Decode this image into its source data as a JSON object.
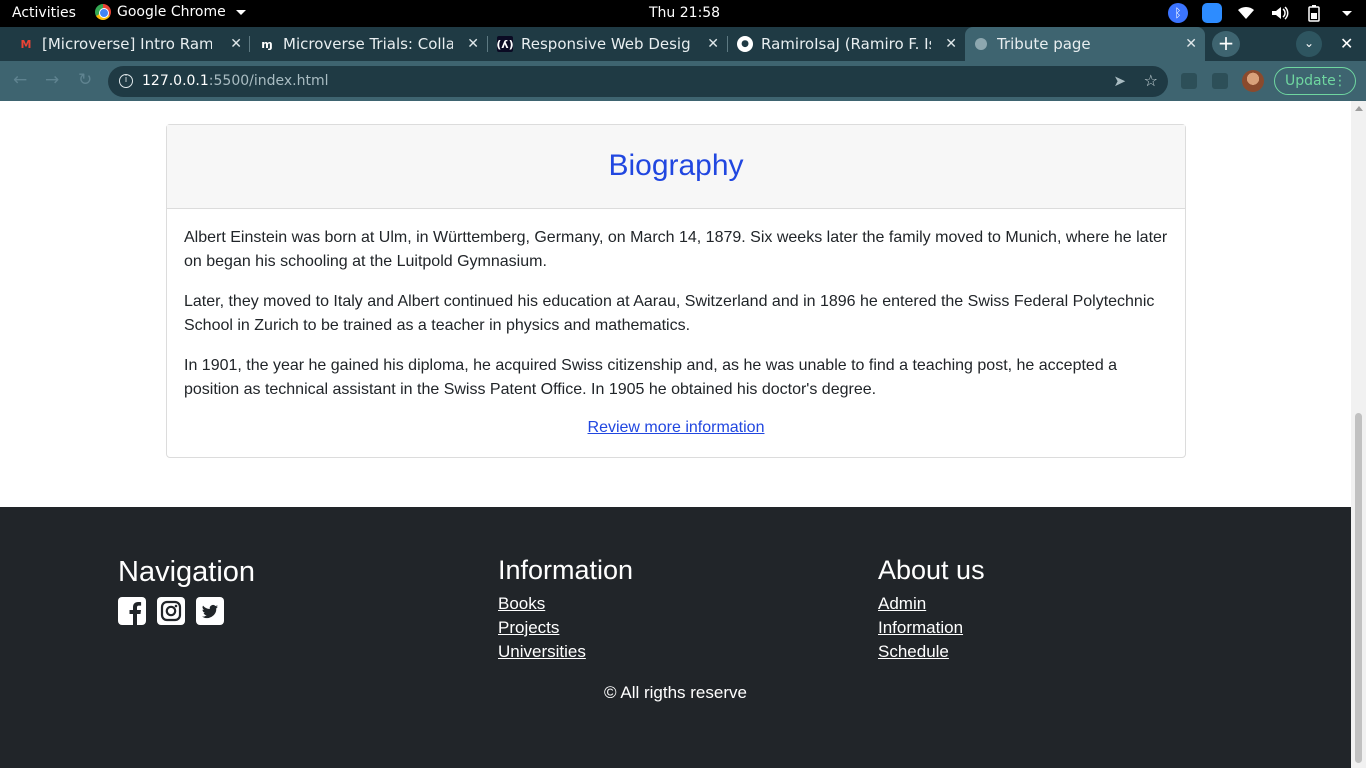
{
  "system": {
    "activities": "Activities",
    "app_name": "Google Chrome",
    "clock": "Thu 21:58"
  },
  "tabs": [
    {
      "label": "[Microverse] Intro Ramiro",
      "favicon": "gmail-icon"
    },
    {
      "label": "Microverse Trials: Collabo",
      "favicon": "microverse-icon"
    },
    {
      "label": "Responsive Web Design P",
      "favicon": "freecodecamp-icon"
    },
    {
      "label": "RamiroIsaJ (Ramiro F. Isa",
      "favicon": "github-icon"
    },
    {
      "label": "Tribute page",
      "favicon": "globe-icon",
      "active": true
    }
  ],
  "omnibox": {
    "host": "127.0.0.1",
    "path": ":5500/index.html"
  },
  "toolbar": {
    "update_label": "Update"
  },
  "card": {
    "title": "Biography",
    "paragraphs": [
      "Albert Einstein was born at Ulm, in Württemberg, Germany, on March 14, 1879. Six weeks later the family moved to Munich, where he later on began his schooling at the Luitpold Gymnasium.",
      "Later, they moved to Italy and Albert continued his education at Aarau, Switzerland and in 1896 he entered the Swiss Federal Polytechnic School in Zurich to be trained as a teacher in physics and mathematics.",
      "In 1901, the year he gained his diploma, he acquired Swiss citizenship and, as he was unable to find a teaching post, he accepted a position as technical assistant in the Swiss Patent Office. In 1905 he obtained his doctor's degree."
    ],
    "link": "Review more information"
  },
  "footer": {
    "navigation": {
      "heading": "Navigation",
      "social": [
        "facebook-icon",
        "instagram-icon",
        "twitter-icon"
      ]
    },
    "information": {
      "heading": "Information",
      "links": [
        "Books",
        "Projects",
        "Universities"
      ]
    },
    "about": {
      "heading": "About us",
      "links": [
        "Admin",
        "Information",
        "Schedule"
      ]
    },
    "copyright": "© All rigths reserve"
  },
  "colors": {
    "heading_blue": "#2147e0",
    "footer_bg": "#212529",
    "tab_active": "#3e6470",
    "tabstrip": "#1f3a44"
  }
}
